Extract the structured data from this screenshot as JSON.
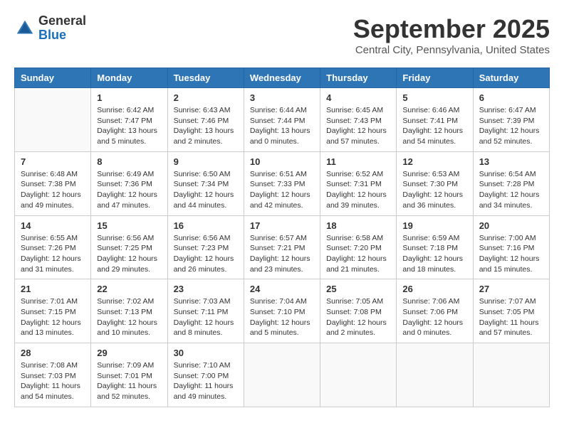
{
  "logo": {
    "general": "General",
    "blue": "Blue"
  },
  "title": "September 2025",
  "location": "Central City, Pennsylvania, United States",
  "weekdays": [
    "Sunday",
    "Monday",
    "Tuesday",
    "Wednesday",
    "Thursday",
    "Friday",
    "Saturday"
  ],
  "weeks": [
    [
      {
        "day": "",
        "sunrise": "",
        "sunset": "",
        "daylight": ""
      },
      {
        "day": "1",
        "sunrise": "Sunrise: 6:42 AM",
        "sunset": "Sunset: 7:47 PM",
        "daylight": "Daylight: 13 hours and 5 minutes."
      },
      {
        "day": "2",
        "sunrise": "Sunrise: 6:43 AM",
        "sunset": "Sunset: 7:46 PM",
        "daylight": "Daylight: 13 hours and 2 minutes."
      },
      {
        "day": "3",
        "sunrise": "Sunrise: 6:44 AM",
        "sunset": "Sunset: 7:44 PM",
        "daylight": "Daylight: 13 hours and 0 minutes."
      },
      {
        "day": "4",
        "sunrise": "Sunrise: 6:45 AM",
        "sunset": "Sunset: 7:43 PM",
        "daylight": "Daylight: 12 hours and 57 minutes."
      },
      {
        "day": "5",
        "sunrise": "Sunrise: 6:46 AM",
        "sunset": "Sunset: 7:41 PM",
        "daylight": "Daylight: 12 hours and 54 minutes."
      },
      {
        "day": "6",
        "sunrise": "Sunrise: 6:47 AM",
        "sunset": "Sunset: 7:39 PM",
        "daylight": "Daylight: 12 hours and 52 minutes."
      }
    ],
    [
      {
        "day": "7",
        "sunrise": "Sunrise: 6:48 AM",
        "sunset": "Sunset: 7:38 PM",
        "daylight": "Daylight: 12 hours and 49 minutes."
      },
      {
        "day": "8",
        "sunrise": "Sunrise: 6:49 AM",
        "sunset": "Sunset: 7:36 PM",
        "daylight": "Daylight: 12 hours and 47 minutes."
      },
      {
        "day": "9",
        "sunrise": "Sunrise: 6:50 AM",
        "sunset": "Sunset: 7:34 PM",
        "daylight": "Daylight: 12 hours and 44 minutes."
      },
      {
        "day": "10",
        "sunrise": "Sunrise: 6:51 AM",
        "sunset": "Sunset: 7:33 PM",
        "daylight": "Daylight: 12 hours and 42 minutes."
      },
      {
        "day": "11",
        "sunrise": "Sunrise: 6:52 AM",
        "sunset": "Sunset: 7:31 PM",
        "daylight": "Daylight: 12 hours and 39 minutes."
      },
      {
        "day": "12",
        "sunrise": "Sunrise: 6:53 AM",
        "sunset": "Sunset: 7:30 PM",
        "daylight": "Daylight: 12 hours and 36 minutes."
      },
      {
        "day": "13",
        "sunrise": "Sunrise: 6:54 AM",
        "sunset": "Sunset: 7:28 PM",
        "daylight": "Daylight: 12 hours and 34 minutes."
      }
    ],
    [
      {
        "day": "14",
        "sunrise": "Sunrise: 6:55 AM",
        "sunset": "Sunset: 7:26 PM",
        "daylight": "Daylight: 12 hours and 31 minutes."
      },
      {
        "day": "15",
        "sunrise": "Sunrise: 6:56 AM",
        "sunset": "Sunset: 7:25 PM",
        "daylight": "Daylight: 12 hours and 29 minutes."
      },
      {
        "day": "16",
        "sunrise": "Sunrise: 6:56 AM",
        "sunset": "Sunset: 7:23 PM",
        "daylight": "Daylight: 12 hours and 26 minutes."
      },
      {
        "day": "17",
        "sunrise": "Sunrise: 6:57 AM",
        "sunset": "Sunset: 7:21 PM",
        "daylight": "Daylight: 12 hours and 23 minutes."
      },
      {
        "day": "18",
        "sunrise": "Sunrise: 6:58 AM",
        "sunset": "Sunset: 7:20 PM",
        "daylight": "Daylight: 12 hours and 21 minutes."
      },
      {
        "day": "19",
        "sunrise": "Sunrise: 6:59 AM",
        "sunset": "Sunset: 7:18 PM",
        "daylight": "Daylight: 12 hours and 18 minutes."
      },
      {
        "day": "20",
        "sunrise": "Sunrise: 7:00 AM",
        "sunset": "Sunset: 7:16 PM",
        "daylight": "Daylight: 12 hours and 15 minutes."
      }
    ],
    [
      {
        "day": "21",
        "sunrise": "Sunrise: 7:01 AM",
        "sunset": "Sunset: 7:15 PM",
        "daylight": "Daylight: 12 hours and 13 minutes."
      },
      {
        "day": "22",
        "sunrise": "Sunrise: 7:02 AM",
        "sunset": "Sunset: 7:13 PM",
        "daylight": "Daylight: 12 hours and 10 minutes."
      },
      {
        "day": "23",
        "sunrise": "Sunrise: 7:03 AM",
        "sunset": "Sunset: 7:11 PM",
        "daylight": "Daylight: 12 hours and 8 minutes."
      },
      {
        "day": "24",
        "sunrise": "Sunrise: 7:04 AM",
        "sunset": "Sunset: 7:10 PM",
        "daylight": "Daylight: 12 hours and 5 minutes."
      },
      {
        "day": "25",
        "sunrise": "Sunrise: 7:05 AM",
        "sunset": "Sunset: 7:08 PM",
        "daylight": "Daylight: 12 hours and 2 minutes."
      },
      {
        "day": "26",
        "sunrise": "Sunrise: 7:06 AM",
        "sunset": "Sunset: 7:06 PM",
        "daylight": "Daylight: 12 hours and 0 minutes."
      },
      {
        "day": "27",
        "sunrise": "Sunrise: 7:07 AM",
        "sunset": "Sunset: 7:05 PM",
        "daylight": "Daylight: 11 hours and 57 minutes."
      }
    ],
    [
      {
        "day": "28",
        "sunrise": "Sunrise: 7:08 AM",
        "sunset": "Sunset: 7:03 PM",
        "daylight": "Daylight: 11 hours and 54 minutes."
      },
      {
        "day": "29",
        "sunrise": "Sunrise: 7:09 AM",
        "sunset": "Sunset: 7:01 PM",
        "daylight": "Daylight: 11 hours and 52 minutes."
      },
      {
        "day": "30",
        "sunrise": "Sunrise: 7:10 AM",
        "sunset": "Sunset: 7:00 PM",
        "daylight": "Daylight: 11 hours and 49 minutes."
      },
      {
        "day": "",
        "sunrise": "",
        "sunset": "",
        "daylight": ""
      },
      {
        "day": "",
        "sunrise": "",
        "sunset": "",
        "daylight": ""
      },
      {
        "day": "",
        "sunrise": "",
        "sunset": "",
        "daylight": ""
      },
      {
        "day": "",
        "sunrise": "",
        "sunset": "",
        "daylight": ""
      }
    ]
  ]
}
